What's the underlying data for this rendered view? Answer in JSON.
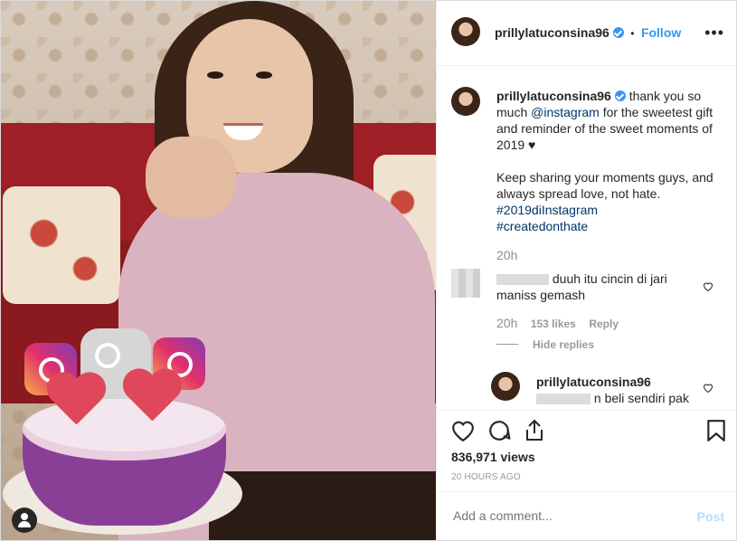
{
  "header": {
    "username": "prillylatuconsina96",
    "separator": "•",
    "follow_label": "Follow",
    "more_icon": "more-options-icon"
  },
  "caption": {
    "username": "prillylatuconsina96",
    "text_part1": "thank you so much ",
    "mention": "@instagram",
    "text_part2": " for the sweetest gift and reminder of the sweet moments of 2019 ",
    "heart": "♥",
    "paragraph2": "Keep sharing your moments guys, and always spread love, not hate.",
    "hashtag1": "#2019diInstagram",
    "hashtag2": "#createdonthate",
    "time": "20h"
  },
  "comments": [
    {
      "text": "duuh itu cincin di jari maniss gemash",
      "time": "20h",
      "likes": "153 likes",
      "reply_label": "Reply",
      "hide_replies_label": "Hide replies"
    }
  ],
  "reply": {
    "username": "prillylatuconsina96",
    "text": "n beli sendiri pak"
  },
  "stats": {
    "views": "836,971 views",
    "posted": "20 HOURS AGO"
  },
  "add_comment": {
    "placeholder": "Add a comment...",
    "post_label": "Post"
  },
  "colors": {
    "accent": "#3897f0",
    "link": "#003569",
    "post_disabled": "#b2dffc",
    "muted": "#8e8e8e"
  }
}
